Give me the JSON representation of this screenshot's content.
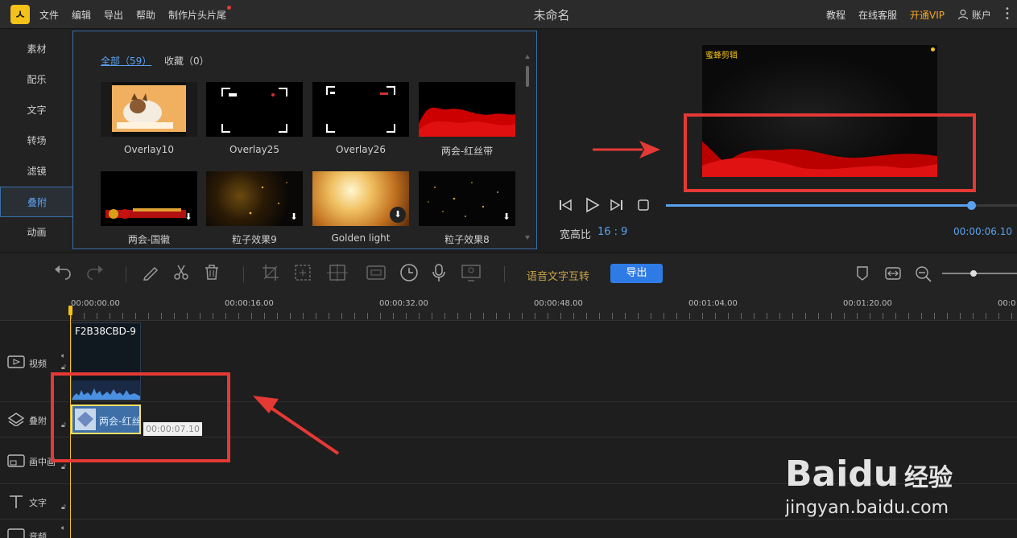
{
  "app": {
    "title": "未命名",
    "logo_glyph": "ㅅ"
  },
  "menu": [
    "文件",
    "编辑",
    "导出",
    "帮助",
    "制作片头片尾"
  ],
  "topright": {
    "tutorial": "教程",
    "support": "在线客服",
    "vip": "开通VIP",
    "account": "账户"
  },
  "sidebar": {
    "items": [
      "素材",
      "配乐",
      "文字",
      "转场",
      "滤镜",
      "叠附",
      "动画"
    ],
    "active": "叠附"
  },
  "library": {
    "tabs": [
      "全部（59）",
      "收藏（0）"
    ],
    "items": [
      {
        "label": "Overlay10",
        "icon": "cat-photo"
      },
      {
        "label": "Overlay25",
        "icon": "frame-overlay"
      },
      {
        "label": "Overlay26",
        "icon": "frame-overlay"
      },
      {
        "label": "两会-红丝带",
        "icon": "red-ribbon"
      },
      {
        "label": "两会-国徽",
        "icon": "emblem-banner"
      },
      {
        "label": "粒子效果9",
        "icon": "particles"
      },
      {
        "label": "Golden light",
        "icon": "golden-light"
      },
      {
        "label": "粒子效果8",
        "icon": "particles"
      }
    ]
  },
  "preview": {
    "watermark": "蜜蜂剪辑",
    "ratio_label": "宽高比",
    "ratio_value": "16 : 9",
    "time": "00:00:06.10",
    "progress": 0.87
  },
  "toolbar": {
    "speech_to_text": "语音文字互转",
    "export": "导出"
  },
  "ruler": [
    "00:00:00.00",
    "00:00:16.00",
    "00:00:32.00",
    "00:00:48.00",
    "00:01:04.00",
    "00:01:20.00",
    "00:0"
  ],
  "tracks": {
    "video": "视频",
    "overlay": "叠附",
    "pip": "画中画",
    "text": "文字",
    "audio": "音频"
  },
  "clips": {
    "video_name": "F2B38CBD-9",
    "overlay_name": "两会-红丝",
    "overlay_time": "00:00:07.10"
  },
  "watermark": {
    "brand": "Baidu",
    "cn": "经验",
    "url": "jingyan.baidu.com"
  },
  "colors": {
    "accent": "#5aa2ee",
    "vip": "#f5a623",
    "highlight": "#e53935",
    "playhead": "#f3c11a"
  }
}
